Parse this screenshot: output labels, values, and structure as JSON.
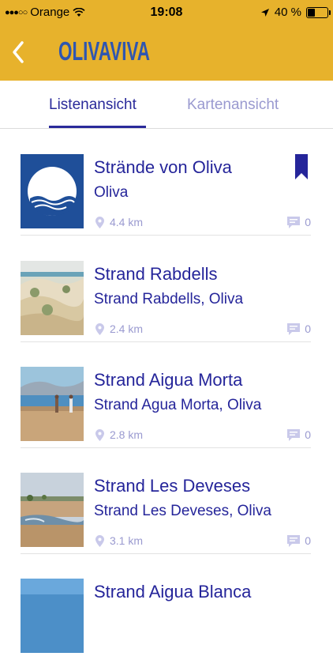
{
  "status": {
    "carrier": "Orange",
    "time": "19:08",
    "battery_percent": "40 %",
    "battery_level": 0.4
  },
  "header": {
    "back_icon": "chevron-left-icon",
    "brand": "OLIVAVIVA"
  },
  "tabs": [
    {
      "label": "Listenansicht",
      "active": true
    },
    {
      "label": "Kartenansicht",
      "active": false
    }
  ],
  "items": [
    {
      "title": "Strände von Oliva",
      "subtitle": "Oliva",
      "distance": "4.4 km",
      "comments": "0",
      "thumb": "blue-flag",
      "bookmarked": true
    },
    {
      "title": "Strand Rabdells",
      "subtitle": "Strand Rabdells, Oliva",
      "distance": "2.4 km",
      "comments": "0",
      "thumb": "dunes",
      "bookmarked": false
    },
    {
      "title": "Strand Aigua Morta",
      "subtitle": "Strand Agua Morta, Oliva",
      "distance": "2.8 km",
      "comments": "0",
      "thumb": "beach-people",
      "bookmarked": false
    },
    {
      "title": "Strand Les Deveses",
      "subtitle": "Strand Les Deveses, Oliva",
      "distance": "3.1 km",
      "comments": "0",
      "thumb": "shore",
      "bookmarked": false
    },
    {
      "title": "Strand Aigua Blanca",
      "subtitle": "",
      "distance": "",
      "comments": "",
      "thumb": "sea",
      "bookmarked": false
    }
  ],
  "colors": {
    "accent": "#e7b22c",
    "brand": "#2f56b0",
    "text": "#25259a",
    "muted": "#9a9ad0"
  }
}
